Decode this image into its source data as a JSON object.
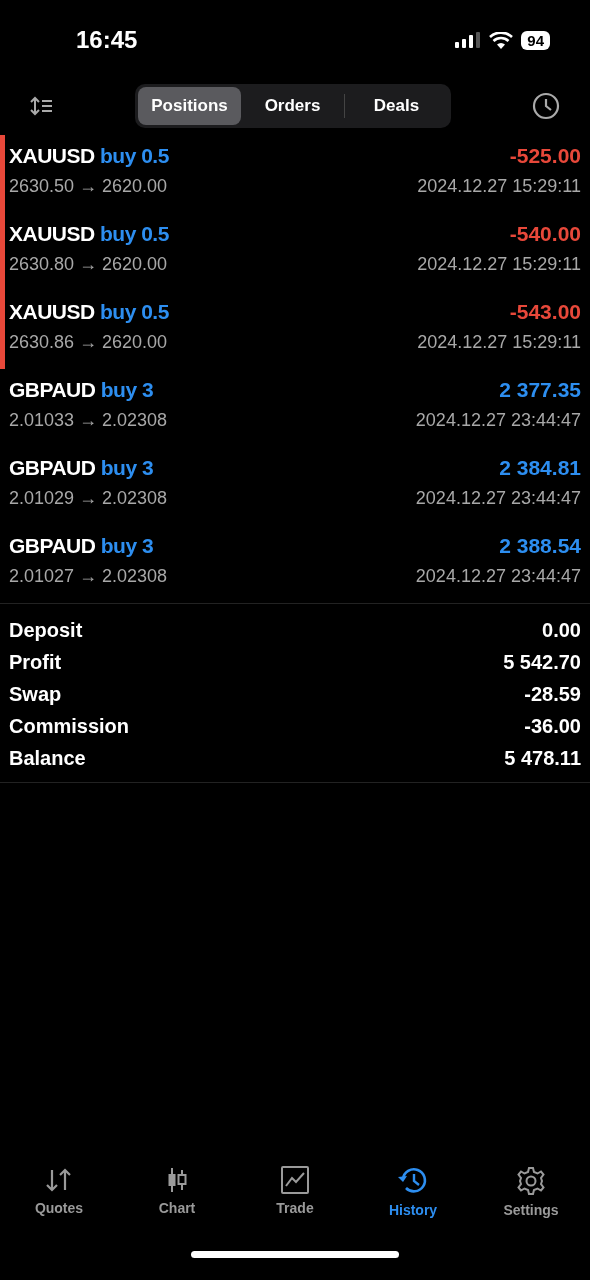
{
  "status_bar": {
    "time": "16:45",
    "battery": "94"
  },
  "tabs": [
    {
      "label": "Positions",
      "selected": true
    },
    {
      "label": "Orders",
      "selected": false
    },
    {
      "label": "Deals",
      "selected": false
    }
  ],
  "positions": [
    {
      "symbol": "XAUUSD",
      "side": "buy 0.5",
      "prices": "2630.50 → 2620.00",
      "profit": "-525.00",
      "color": "#e8483a",
      "marker": true,
      "time": "2024.12.27 15:29:11"
    },
    {
      "symbol": "XAUUSD",
      "side": "buy 0.5",
      "prices": "2630.80 → 2620.00",
      "profit": "-540.00",
      "color": "#e8483a",
      "marker": true,
      "time": "2024.12.27 15:29:11"
    },
    {
      "symbol": "XAUUSD",
      "side": "buy 0.5",
      "prices": "2630.86 → 2620.00",
      "profit": "-543.00",
      "color": "#e8483a",
      "marker": true,
      "time": "2024.12.27 15:29:11"
    },
    {
      "symbol": "GBPAUD",
      "side": "buy 3",
      "prices": "2.01033 → 2.02308",
      "profit": "2 377.35",
      "color": "#2d8ef0",
      "marker": false,
      "time": "2024.12.27 23:44:47"
    },
    {
      "symbol": "GBPAUD",
      "side": "buy 3",
      "prices": "2.01029 → 2.02308",
      "profit": "2 384.81",
      "color": "#2d8ef0",
      "marker": false,
      "time": "2024.12.27 23:44:47"
    },
    {
      "symbol": "GBPAUD",
      "side": "buy 3",
      "prices": "2.01027 → 2.02308",
      "profit": "2 388.54",
      "color": "#2d8ef0",
      "marker": false,
      "time": "2024.12.27 23:44:47"
    }
  ],
  "summary": [
    {
      "label": "Deposit",
      "value": "0.00"
    },
    {
      "label": "Profit",
      "value": "5 542.70"
    },
    {
      "label": "Swap",
      "value": "-28.59"
    },
    {
      "label": "Commission",
      "value": "-36.00"
    },
    {
      "label": "Balance",
      "value": "5 478.11"
    }
  ],
  "nav": [
    {
      "label": "Quotes",
      "kind": "quotes",
      "selected": false
    },
    {
      "label": "Chart",
      "kind": "chart",
      "selected": false
    },
    {
      "label": "Trade",
      "kind": "trade",
      "selected": false
    },
    {
      "label": "History",
      "kind": "history",
      "selected": true
    },
    {
      "label": "Settings",
      "kind": "settings",
      "selected": false
    }
  ]
}
